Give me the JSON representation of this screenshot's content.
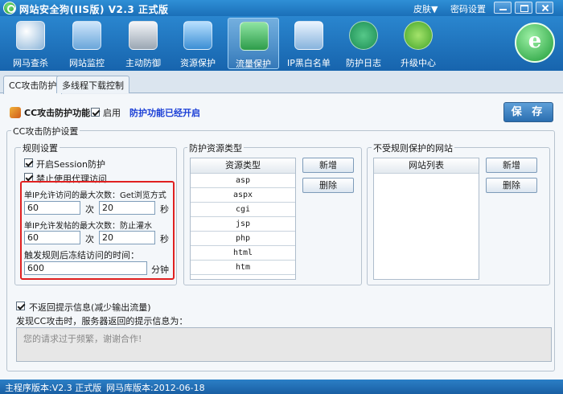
{
  "titlebar": {
    "title": "网站安全狗(IIS版) V2.3 正式版",
    "skin": "皮肤▼",
    "password_settings": "密码设置"
  },
  "toolbar": {
    "items": [
      {
        "label": "网马查杀",
        "icon": "virus-scan-icon"
      },
      {
        "label": "网站监控",
        "icon": "monitor-icon"
      },
      {
        "label": "主动防御",
        "icon": "shield-icon"
      },
      {
        "label": "资源保护",
        "icon": "resource-icon"
      },
      {
        "label": "流量保护",
        "icon": "traffic-shield-icon",
        "active": true
      },
      {
        "label": "IP黑白名单",
        "icon": "ip-list-icon"
      },
      {
        "label": "防护日志",
        "icon": "log-icon"
      },
      {
        "label": "升级中心",
        "icon": "upgrade-icon"
      }
    ],
    "logo": "e"
  },
  "tabs": [
    {
      "label": "CC攻击防护",
      "active": true
    },
    {
      "label": "多线程下载控制",
      "active": false
    }
  ],
  "main": {
    "feature_label": "CC攻击防护功能",
    "enable_label": "启用",
    "enabled": true,
    "status_text": "防护功能已经开启",
    "save_label": "保 存",
    "settings_legend": "CC攻击防护设置",
    "rules": {
      "legend": "规则设置",
      "session_label": "开启Session防护",
      "session_checked": true,
      "proxy_label": "禁止使用代理访问",
      "proxy_checked": true,
      "visit_limit_label": "单IP允许访问的最大次数：Get浏览方式",
      "visit_count": "60",
      "visit_count_unit": "次",
      "visit_seconds": "20",
      "visit_seconds_unit": "秒",
      "post_limit_label": "单IP允许发帖的最大次数：防止灌水",
      "post_count": "60",
      "post_count_unit": "次",
      "post_seconds": "20",
      "post_seconds_unit": "秒",
      "freeze_label": "触发规则后冻结访问的时间：",
      "freeze_minutes": "600",
      "freeze_unit": "分钟"
    },
    "resources": {
      "legend": "防护资源类型",
      "column": "资源类型",
      "items": [
        "asp",
        "aspx",
        "cgi",
        "jsp",
        "php",
        "html",
        "htm"
      ],
      "add_label": "新增",
      "delete_label": "删除"
    },
    "exempt": {
      "legend": "不受规则保护的网站",
      "column": "网站列表",
      "add_label": "新增",
      "delete_label": "删除"
    },
    "no_prompt_label": "不返回提示信息(减少输出流量)",
    "no_prompt_checked": true,
    "prompt_caption": "发现CC攻击时，服务器返回的提示信息为：",
    "prompt_text": "您的请求过于频繁，谢谢合作!"
  },
  "statusbar": {
    "main_version": "主程序版本:V2.3 正式版",
    "db_version": "网马库版本:2012-06-18"
  }
}
